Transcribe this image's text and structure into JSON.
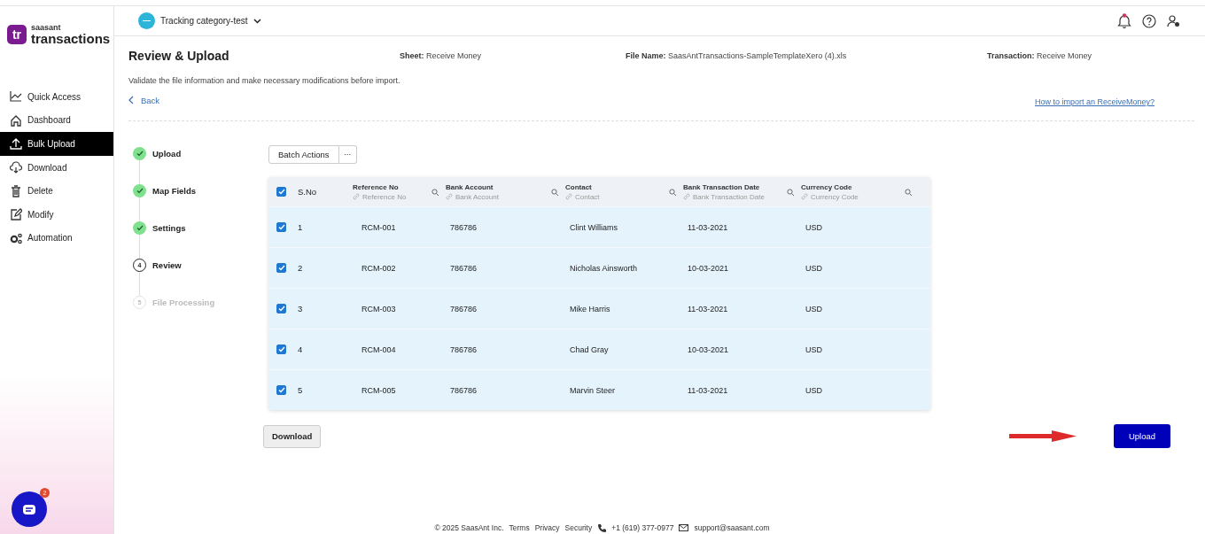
{
  "brand": {
    "logo_mark": "tr",
    "small": "saasant",
    "name": "transactions"
  },
  "sidebar": {
    "items": [
      {
        "label": "Quick Access",
        "selected": false
      },
      {
        "label": "Dashboard",
        "selected": false
      },
      {
        "label": "Bulk Upload",
        "selected": true
      },
      {
        "label": "Download",
        "selected": false
      },
      {
        "label": "Delete",
        "selected": false
      },
      {
        "label": "Modify",
        "selected": false
      },
      {
        "label": "Automation",
        "selected": false
      }
    ]
  },
  "chat": {
    "badge": "2"
  },
  "topbar": {
    "org": "Tracking category-test",
    "notification": true
  },
  "header": {
    "title": "Review & Upload",
    "meta": [
      {
        "label": "Sheet:",
        "value": "Receive Money"
      },
      {
        "label": "File Name:",
        "value": "SaasAntTransactions-SampleTemplateXero (4).xls"
      },
      {
        "label": "Transaction:",
        "value": "Receive Money"
      }
    ],
    "description": "Validate the file information and make necessary modifications before import.",
    "back": "Back",
    "help_link": "How to import an ReceiveMoney?"
  },
  "steps": [
    {
      "label": "Upload",
      "kind": "done"
    },
    {
      "label": "Map Fields",
      "kind": "done"
    },
    {
      "label": "Settings",
      "kind": "done"
    },
    {
      "number": "4",
      "label": "Review",
      "kind": "current"
    },
    {
      "number": "5",
      "label": "File Processing",
      "kind": "pending"
    }
  ],
  "toolbar": {
    "batch": "Batch Actions",
    "more": "···"
  },
  "table": {
    "all_checked": true,
    "sno_label": "S.No",
    "columns": [
      {
        "title": "Reference No",
        "mapped": "Reference No"
      },
      {
        "title": "Bank Account",
        "mapped": "Bank Account"
      },
      {
        "title": "Contact",
        "mapped": "Contact"
      },
      {
        "title": "Bank Transaction Date",
        "mapped": "Bank Transaction Date"
      },
      {
        "title": "Currency Code",
        "mapped": "Currency Code"
      }
    ],
    "rows": [
      {
        "checked": true,
        "sno": "1",
        "cells": [
          "RCM-001",
          "786786",
          "Clint Williams",
          "11-03-2021",
          "USD"
        ]
      },
      {
        "checked": true,
        "sno": "2",
        "cells": [
          "RCM-002",
          "786786",
          "Nicholas Ainsworth",
          "10-03-2021",
          "USD"
        ]
      },
      {
        "checked": true,
        "sno": "3",
        "cells": [
          "RCM-003",
          "786786",
          "Mike Harris",
          "11-03-2021",
          "USD"
        ]
      },
      {
        "checked": true,
        "sno": "4",
        "cells": [
          "RCM-004",
          "786786",
          "Chad Gray",
          "10-03-2021",
          "USD"
        ]
      },
      {
        "checked": true,
        "sno": "5",
        "cells": [
          "RCM-005",
          "786786",
          "Marvin Steer",
          "11-03-2021",
          "USD"
        ]
      }
    ]
  },
  "actions": {
    "download": "Download",
    "upload": "Upload"
  },
  "footer": {
    "copyright": "© 2025 SaasAnt Inc.",
    "links": [
      "Terms",
      "Privacy",
      "Security"
    ],
    "phone": "+1 (619) 377-0977",
    "email": "support@saasant.com"
  }
}
